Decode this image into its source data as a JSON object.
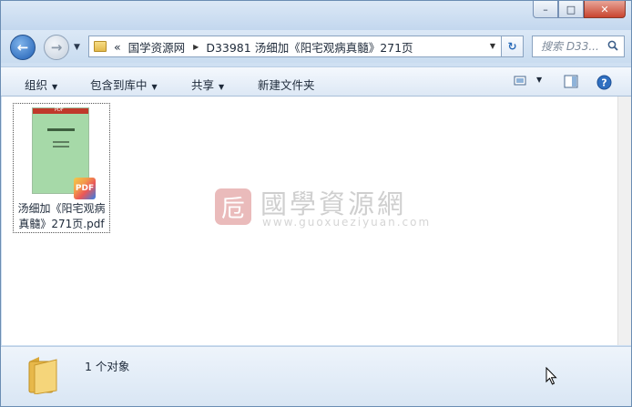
{
  "window": {
    "controls": {
      "minimize": "–",
      "maximize": "□",
      "close": "✕"
    }
  },
  "nav": {
    "back_glyph": "←",
    "forward_glyph": "→",
    "address": {
      "overflow": "«",
      "segments": [
        "国学资源网",
        "D33981 汤细加《阳宅观病真髓》271页"
      ]
    },
    "search_placeholder": "搜索 D33..."
  },
  "toolbar": {
    "organize": "组织",
    "include_in_library": "包含到库中",
    "share": "共享",
    "new_folder": "新建文件夹"
  },
  "files": [
    {
      "name": "汤细加《阳宅观病真髓》271页.pdf",
      "badge": "PDF",
      "thumb_band_text": "PDF"
    }
  ],
  "watermark": {
    "seal": "卮",
    "title": "國學資源網",
    "url": "www.guoxueziyuan.com"
  },
  "status": {
    "count_text": "1 个对象"
  }
}
